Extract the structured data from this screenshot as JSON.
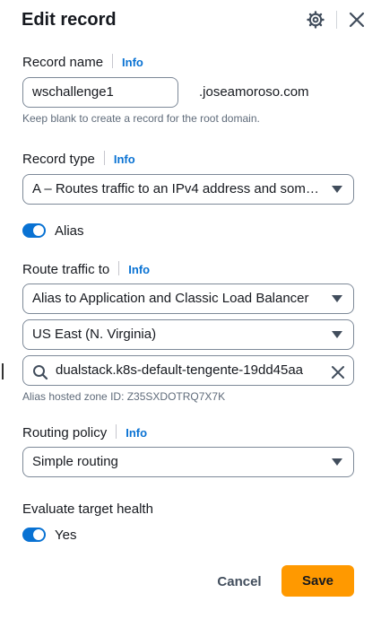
{
  "header": {
    "title": "Edit record"
  },
  "record_name": {
    "label": "Record name",
    "info": "Info",
    "value": "wschallenge1",
    "suffix": ".joseamoroso.com",
    "hint": "Keep blank to create a record for the root domain."
  },
  "record_type": {
    "label": "Record type",
    "info": "Info",
    "selected": "A – Routes traffic to an IPv4 address and some AWS resources"
  },
  "alias": {
    "label": "Alias",
    "enabled": true
  },
  "route_traffic": {
    "label": "Route traffic to",
    "info": "Info",
    "endpoint": "Alias to Application and Classic Load Balancer",
    "region": "US East (N. Virginia)",
    "search_value": "dualstack.k8s-default-tengente-19dd45aa",
    "hosted_zone": "Alias hosted zone ID: Z35SXDOTRQ7X7K"
  },
  "routing_policy": {
    "label": "Routing policy",
    "info": "Info",
    "selected": "Simple routing"
  },
  "evaluate_health": {
    "label": "Evaluate target health",
    "toggle_label": "Yes",
    "enabled": true
  },
  "actions": {
    "cancel": "Cancel",
    "save": "Save"
  },
  "colors": {
    "accent": "#0972d3",
    "primary_button": "#ff9900"
  }
}
